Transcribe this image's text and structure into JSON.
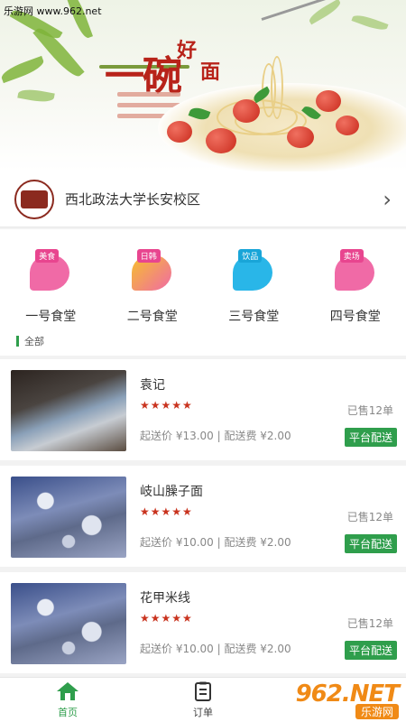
{
  "watermark": {
    "site": "乐游网 www.962.net",
    "logo_big": "962.NET",
    "logo_small": "乐游网"
  },
  "banner": {
    "title_big": "一碗",
    "title_small_1": "好",
    "title_small_2": "面"
  },
  "location": {
    "name": "西北政法大学长安校区"
  },
  "categories": [
    {
      "label": "一号食堂",
      "badge": "美食",
      "color": "#e8458f"
    },
    {
      "label": "二号食堂",
      "badge": "日韩",
      "color": "#e8458f"
    },
    {
      "label": "三号食堂",
      "badge": "饮品",
      "color": "#19a5d8"
    },
    {
      "label": "四号食堂",
      "badge": "卖场",
      "color": "#e8458f"
    }
  ],
  "section": {
    "title": "全部"
  },
  "shops": [
    {
      "name": "袁记",
      "stars": "★★★★★",
      "fee": "起送价 ¥13.00 | 配送费 ¥2.00",
      "sold": "已售12单",
      "tag": "平台配送"
    },
    {
      "name": "岐山臊子面",
      "stars": "★★★★★",
      "fee": "起送价 ¥10.00 | 配送费 ¥2.00",
      "sold": "已售12单",
      "tag": "平台配送"
    },
    {
      "name": "花甲米线",
      "stars": "★★★★★",
      "fee": "起送价 ¥10.00 | 配送费 ¥2.00",
      "sold": "已售12单",
      "tag": "平台配送"
    }
  ],
  "tabs": {
    "home": "首页",
    "orders": "订单"
  }
}
